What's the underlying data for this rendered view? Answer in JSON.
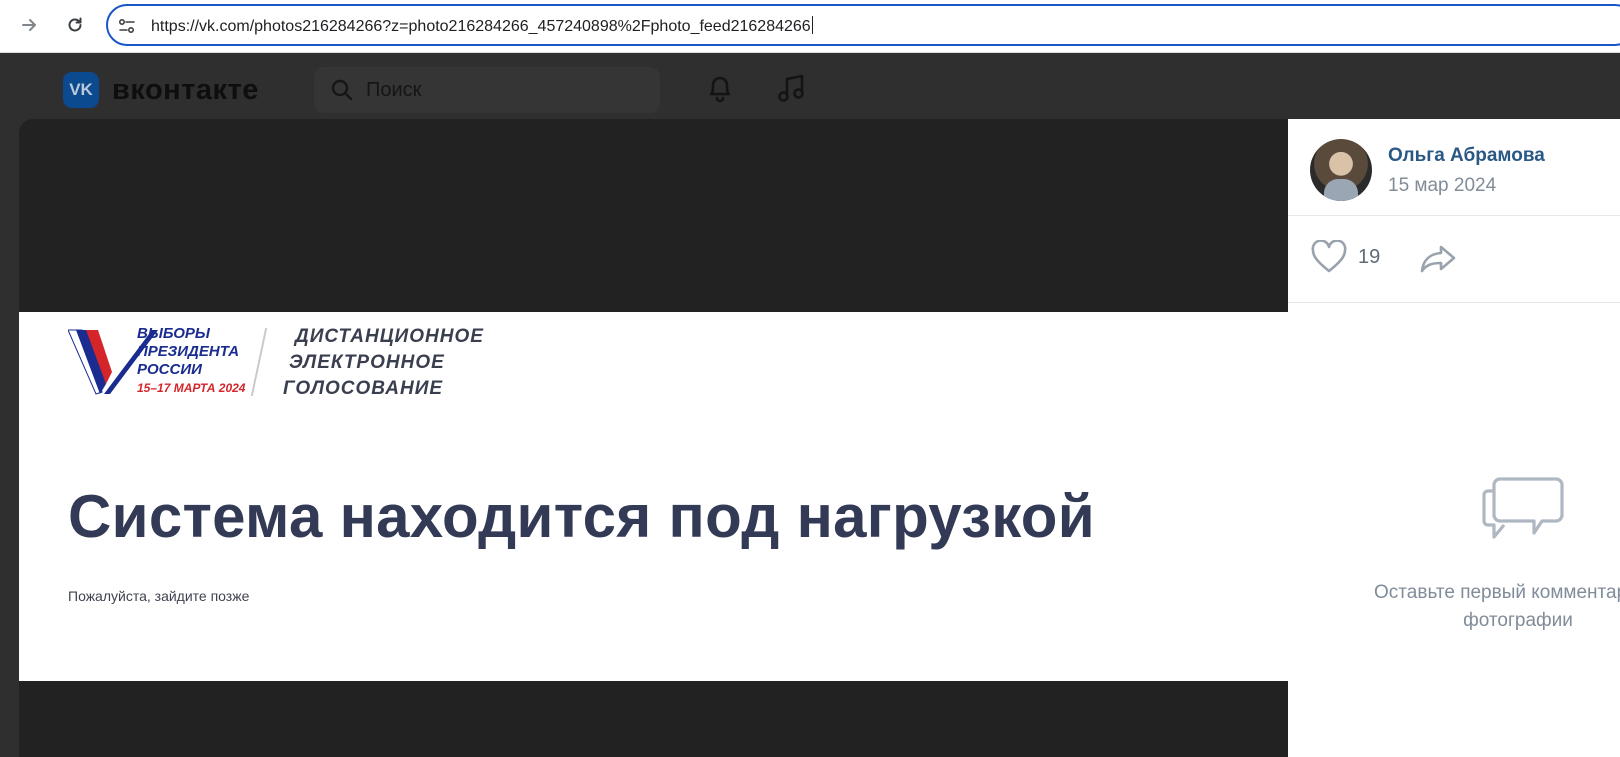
{
  "browser": {
    "url_host": "https://vk.com",
    "url_path": "/photos216284266?z=photo216284266_457240898%2Fphoto_feed216284266",
    "back_icon": "arrow-right-icon",
    "reload_icon": "reload-icon",
    "site_info_icon": "tune-icon"
  },
  "vk": {
    "logo_mark": "VK",
    "logo_text": "вконтакте",
    "search_placeholder": "Поиск",
    "notifications_icon": "bell-icon",
    "music_icon": "music-note-icon"
  },
  "photo": {
    "emblem_line1": "ВЫБОРЫ",
    "emblem_line2": "ПРЕЗИДЕНТА",
    "emblem_line3": "РОССИИ",
    "emblem_dates": "15–17 МАРТА 2024",
    "evote_line1": "ДИСТАНЦИОННОЕ",
    "evote_line2": "ЭЛЕКТРОННОЕ",
    "evote_line3": "ГОЛОСОВАНИЕ",
    "headline": "Система находится под нагрузкой",
    "subline": "Пожалуйста, зайдите позже"
  },
  "panel": {
    "author_name": "Ольга Абрамова",
    "date": "15 мар 2024",
    "likes": "19",
    "empty_comments_line1": "Оставьте первый комментарий к",
    "empty_comments_line2": "фотографии"
  },
  "colors": {
    "accent": "#2a5885",
    "url_border": "#1a56c9",
    "vk_header": "#2f2f2f",
    "viewer_bg": "#222222",
    "headline": "#333a56"
  }
}
